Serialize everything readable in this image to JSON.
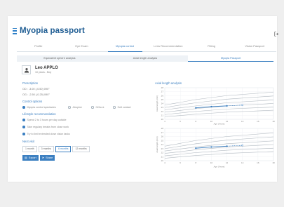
{
  "app": {
    "title": "Myopia passport"
  },
  "main_tabs": [
    {
      "label": "Profile"
    },
    {
      "label": "Eye Exam"
    },
    {
      "label": "Myopia control"
    },
    {
      "label": "Lens Recommendation"
    },
    {
      "label": "Fitting"
    },
    {
      "label": "Vision Passport"
    }
  ],
  "sub_tabs": [
    {
      "label": "Equivalent sphere analysis"
    },
    {
      "label": "Axial length analysis"
    },
    {
      "label": "Myopia Passport"
    }
  ],
  "patient": {
    "name": "Leo APPLO",
    "info": "10 years - Boy"
  },
  "prescription": {
    "heading": "Prescription",
    "od": "OD : -3.00 (-0.50) 090°",
    "og": "OG : -2.50 (-0.25) 090°"
  },
  "control_options": {
    "heading": "Control options",
    "items": [
      {
        "label": "Myopia control spectacles",
        "selected": true
      },
      {
        "label": "Atropine",
        "selected": false
      },
      {
        "label": "Ortho-k",
        "selected": false
      },
      {
        "label": "Soft contact",
        "selected": false
      }
    ]
  },
  "lifestyle": {
    "heading": "Lifestyle recommendation",
    "items": [
      {
        "label": "Spend 2 to 3 hours per day outside"
      },
      {
        "label": "Take regulary breaks from close work"
      },
      {
        "label": "Try to limit extended close vision tasks"
      }
    ]
  },
  "next_visit": {
    "heading": "Next visit",
    "options": [
      {
        "label": "1 month",
        "active": false
      },
      {
        "label": "3 months",
        "active": false
      },
      {
        "label": "6 months",
        "active": true
      },
      {
        "label": "12 months",
        "active": false
      }
    ]
  },
  "actions": {
    "export_label": "Export",
    "share_label": "Share"
  },
  "chart_section": {
    "title": "Axial length analysis"
  },
  "chart_data": [
    {
      "type": "line",
      "xlabel": "Age (Years)",
      "ylabel": "Axial length (mm)",
      "xlim": [
        4,
        18
      ],
      "ylim": [
        20,
        28
      ],
      "x_ticks": [
        4,
        6,
        8,
        10,
        12,
        14,
        16,
        18
      ],
      "y_ticks": [
        20,
        21,
        22,
        23,
        24,
        25,
        26,
        27,
        28
      ],
      "grid": true,
      "series": [
        {
          "role": "percentile",
          "values": [
            [
              4,
              20.6
            ],
            [
              8,
              21.3
            ],
            [
              12,
              21.8
            ],
            [
              18,
              22.3
            ]
          ]
        },
        {
          "role": "percentile",
          "values": [
            [
              4,
              21.2
            ],
            [
              8,
              22.0
            ],
            [
              12,
              22.6
            ],
            [
              18,
              23.1
            ]
          ]
        },
        {
          "role": "percentile",
          "values": [
            [
              4,
              21.8
            ],
            [
              8,
              22.7
            ],
            [
              12,
              23.4
            ],
            [
              18,
              24.0
            ]
          ]
        },
        {
          "role": "percentile",
          "values": [
            [
              4,
              22.4
            ],
            [
              8,
              23.4
            ],
            [
              12,
              24.2
            ],
            [
              18,
              24.9
            ]
          ]
        },
        {
          "role": "percentile",
          "values": [
            [
              4,
              23.0
            ],
            [
              8,
              24.2
            ],
            [
              12,
              25.1
            ],
            [
              18,
              25.9
            ]
          ]
        },
        {
          "role": "percentile",
          "values": [
            [
              4,
              23.6
            ],
            [
              8,
              25.0
            ],
            [
              12,
              26.0
            ],
            [
              18,
              26.9
            ]
          ]
        },
        {
          "role": "patient",
          "values": [
            [
              8,
              22.9
            ],
            [
              10,
              23.2
            ],
            [
              12,
              23.4
            ]
          ]
        },
        {
          "role": "patient-projection",
          "values": [
            [
              12,
              23.4
            ],
            [
              14,
              23.6
            ]
          ]
        }
      ]
    },
    {
      "type": "line",
      "xlabel": "Age (Years)",
      "ylabel": "Axial length (mm)",
      "xlim": [
        4,
        18
      ],
      "ylim": [
        20,
        28
      ],
      "x_ticks": [
        4,
        6,
        8,
        10,
        12,
        14,
        16,
        18
      ],
      "y_ticks": [
        20,
        21,
        22,
        23,
        24,
        25,
        26,
        27,
        28
      ],
      "grid": true,
      "series": [
        {
          "role": "percentile",
          "values": [
            [
              4,
              20.6
            ],
            [
              8,
              21.3
            ],
            [
              12,
              21.8
            ],
            [
              18,
              22.3
            ]
          ]
        },
        {
          "role": "percentile",
          "values": [
            [
              4,
              21.2
            ],
            [
              8,
              22.0
            ],
            [
              12,
              22.6
            ],
            [
              18,
              23.1
            ]
          ]
        },
        {
          "role": "percentile",
          "values": [
            [
              4,
              21.8
            ],
            [
              8,
              22.7
            ],
            [
              12,
              23.4
            ],
            [
              18,
              24.0
            ]
          ]
        },
        {
          "role": "percentile",
          "values": [
            [
              4,
              22.4
            ],
            [
              8,
              23.4
            ],
            [
              12,
              24.2
            ],
            [
              18,
              24.9
            ]
          ]
        },
        {
          "role": "percentile",
          "values": [
            [
              4,
              23.0
            ],
            [
              8,
              24.2
            ],
            [
              12,
              25.1
            ],
            [
              18,
              25.9
            ]
          ]
        },
        {
          "role": "percentile",
          "values": [
            [
              4,
              23.6
            ],
            [
              8,
              25.0
            ],
            [
              12,
              26.0
            ],
            [
              18,
              26.9
            ]
          ]
        },
        {
          "role": "patient",
          "values": [
            [
              8,
              23.1
            ],
            [
              10,
              23.4
            ],
            [
              12,
              23.6
            ]
          ]
        },
        {
          "role": "patient-projection",
          "values": [
            [
              12,
              23.6
            ],
            [
              14,
              23.8
            ]
          ]
        }
      ]
    }
  ],
  "colors": {
    "accent": "#3b7fc1",
    "percentile": "#b5bcc3",
    "patient": "#3b7fc1"
  },
  "icons": {
    "menu": "menu-icon",
    "logout": "logout-icon",
    "avatar": "user-icon",
    "export": "export-icon",
    "share": "share-icon"
  }
}
